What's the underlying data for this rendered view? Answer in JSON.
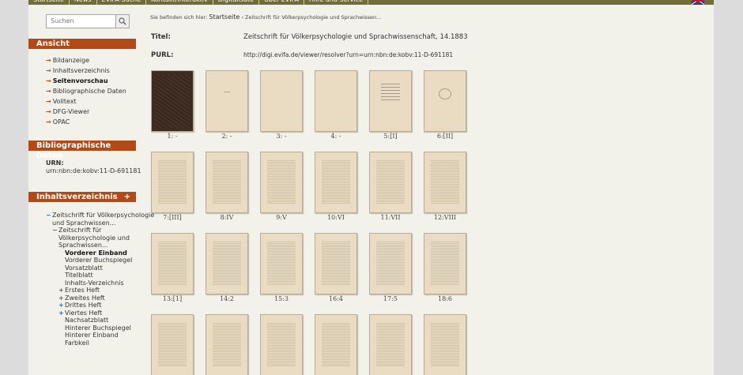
{
  "nav": {
    "items": [
      "Startseite",
      "News",
      "EVIFA-Suche",
      "Kontakt/Interaktiv",
      "Digitalisate",
      "Über EVIFA",
      "Hilfe und Service"
    ],
    "flag_icon": "uk-flag-icon"
  },
  "search": {
    "placeholder": "Suchen",
    "icon": "magnifier-icon"
  },
  "sidebar": {
    "ansicht_title": "Ansicht",
    "ansicht_items": [
      "Bildanzeige",
      "Inhaltsverzeichnis",
      "Seitenvorschau",
      "Bibliographische Daten",
      "Volltext",
      "DFG-Viewer",
      "OPAC"
    ],
    "ansicht_active": "Seitenvorschau",
    "biblio_title": "Bibliographische Daten",
    "urn_label": "URN:",
    "urn_value": "urn:nbn:de:kobv:11-D-691181",
    "toc_title": "Inhaltsverzeichnis",
    "toc_controls": "- +",
    "toc": [
      {
        "sym": "−",
        "text": "Zeitschrift für Völkerpsychologie",
        "indent": 0
      },
      {
        "sym": "",
        "text": "und Sprachwissen...",
        "indent": 1
      },
      {
        "sym": "−",
        "text": "Zeitschrift für",
        "indent": 1
      },
      {
        "sym": "",
        "text": "Völkerpsychologie und",
        "indent": 2
      },
      {
        "sym": "",
        "text": "Sprachwissen...",
        "indent": 2
      },
      {
        "sym": "",
        "text": "Vorderer Einband",
        "indent": 3,
        "bold": true
      },
      {
        "sym": "",
        "text": "Vorderer Buchspiegel",
        "indent": 3
      },
      {
        "sym": "",
        "text": "Vorsatzblatt",
        "indent": 3
      },
      {
        "sym": "",
        "text": "Titelblatt",
        "indent": 3
      },
      {
        "sym": "",
        "text": "Inhalts-Verzeichnis",
        "indent": 3
      },
      {
        "sym": "+",
        "text": "Erstes Heft",
        "indent": 2
      },
      {
        "sym": "+",
        "text": "Zweites Heft",
        "indent": 2
      },
      {
        "sym": "+",
        "text": "Drittes Heft",
        "indent": 2
      },
      {
        "sym": "+",
        "text": "Viertes Heft",
        "indent": 2
      },
      {
        "sym": "",
        "text": "Nachsatzblatt",
        "indent": 3
      },
      {
        "sym": "",
        "text": "Hinterer Buchspiegel",
        "indent": 3
      },
      {
        "sym": "",
        "text": "Hinterer Einband",
        "indent": 3
      },
      {
        "sym": "",
        "text": "Farbkeil",
        "indent": 3
      }
    ]
  },
  "main": {
    "breadcrumb_prefix": "Sie befinden sich hier:",
    "breadcrumb_home": "Startseite",
    "breadcrumb_sep": "›",
    "breadcrumb_current": "Zeitschrift für Völkerpsychologie und Sprachwissen...",
    "title_label": "Titel:",
    "title_value": "Zeitschrift für Völkerpsychologie und Sprachwissenschaft, 14.1883",
    "purl_label": "PURL:",
    "purl_value": "http://digi.evifa.de/viewer/resolver?urn=urn:nbn:de:kobv:11-D-691181",
    "thumbnails": [
      {
        "caption": "1: -",
        "style": "cover"
      },
      {
        "caption": "2: -",
        "style": "mark"
      },
      {
        "caption": "3: -",
        "style": "blank"
      },
      {
        "caption": "4: -",
        "style": "blank"
      },
      {
        "caption": "5:[I]",
        "style": "title"
      },
      {
        "caption": "6:[II]",
        "style": "seal"
      },
      {
        "caption": "7:[III]",
        "style": "text"
      },
      {
        "caption": "8:IV",
        "style": "text"
      },
      {
        "caption": "9:V",
        "style": "text"
      },
      {
        "caption": "10:VI",
        "style": "text"
      },
      {
        "caption": "11:VII",
        "style": "text"
      },
      {
        "caption": "12:VIII",
        "style": "text"
      },
      {
        "caption": "13:[1]",
        "style": "text"
      },
      {
        "caption": "14:2",
        "style": "text"
      },
      {
        "caption": "15:3",
        "style": "text"
      },
      {
        "caption": "16:4",
        "style": "text"
      },
      {
        "caption": "17:5",
        "style": "text"
      },
      {
        "caption": "18:6",
        "style": "text"
      },
      {
        "caption": "",
        "style": "text"
      },
      {
        "caption": "",
        "style": "text"
      },
      {
        "caption": "",
        "style": "text"
      },
      {
        "caption": "",
        "style": "text"
      },
      {
        "caption": "",
        "style": "text"
      },
      {
        "caption": "",
        "style": "text"
      }
    ]
  },
  "colors": {
    "accent": "#b14a16",
    "nav_bg": "#6f6d3a",
    "page_bg": "#f3f2ea",
    "link_blue": "#2a6cc6"
  }
}
